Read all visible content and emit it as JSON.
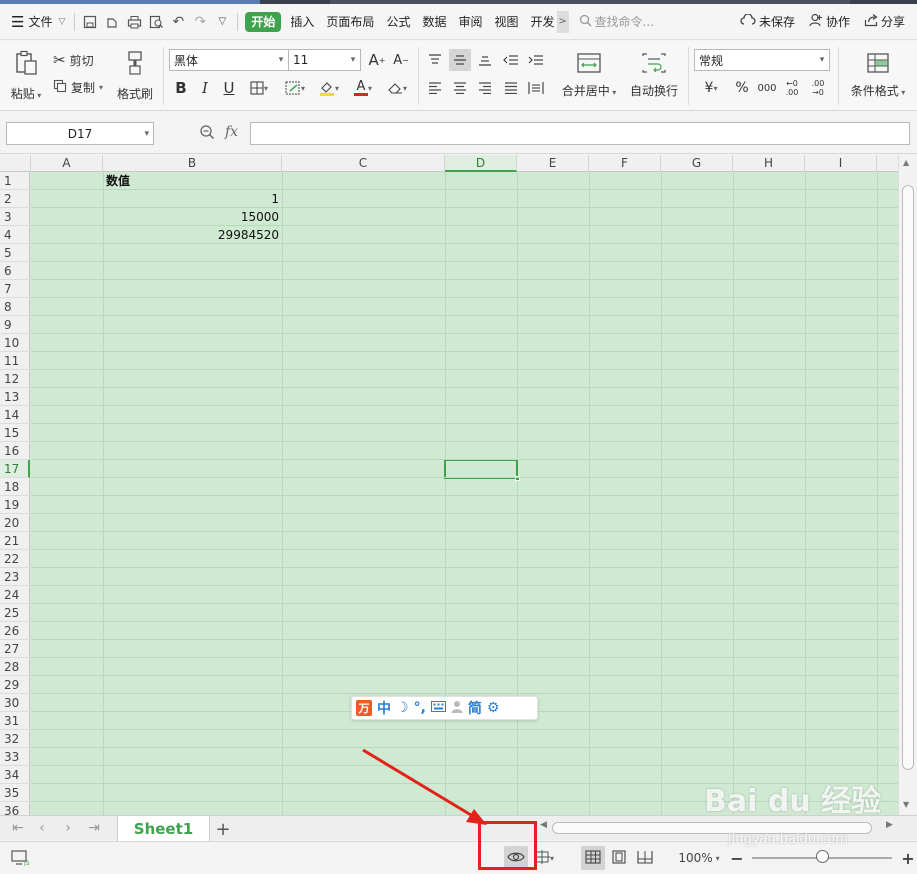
{
  "menubar": {
    "file_label": "文件",
    "tabs": [
      "开始",
      "插入",
      "页面布局",
      "公式",
      "数据",
      "审阅",
      "视图",
      "开发"
    ],
    "active_tab": "开始",
    "search_placeholder": "查找命令...",
    "unsaved_label": "未保存",
    "collab_label": "协作",
    "share_label": "分享"
  },
  "ribbon": {
    "paste_label": "粘贴",
    "cut_label": "剪切",
    "copy_label": "复制",
    "format_painter_label": "格式刷",
    "font_name": "黑体",
    "font_size": "11",
    "bold_label": "B",
    "italic_label": "I",
    "underline_label": "U",
    "font_color_label": "A",
    "merge_center_label": "合并居中",
    "wrap_text_label": "自动换行",
    "number_format": "常规",
    "currency_label": "¥",
    "percent_label": "%",
    "thousands_label": "000",
    "inc_decimal_label": "←0 .00",
    "dec_decimal_label": ".00 →0",
    "conditional_format_label": "条件格式"
  },
  "formulabar": {
    "cell_ref": "D17",
    "fx_label": "fx",
    "formula_value": ""
  },
  "grid": {
    "columns": [
      "A",
      "B",
      "C",
      "D",
      "E",
      "F",
      "G",
      "H",
      "I"
    ],
    "active_column": "D",
    "rows": [
      "1",
      "2",
      "3",
      "4",
      "5",
      "6",
      "7",
      "8",
      "9",
      "10",
      "11",
      "12",
      "13",
      "14",
      "15",
      "16",
      "17",
      "18",
      "19",
      "20",
      "21",
      "22",
      "23",
      "24",
      "25",
      "26",
      "27",
      "28",
      "29",
      "30",
      "31",
      "32",
      "33",
      "34",
      "35",
      "36"
    ],
    "active_row": "17",
    "cells": {
      "B1": "数值",
      "B2": "1",
      "B3": "15000",
      "B4": "29984520"
    }
  },
  "ime": {
    "mode_label": "中",
    "simplified_label": "简"
  },
  "sheetbar": {
    "sheet_name": "Sheet1",
    "add_label": "+"
  },
  "statusbar": {
    "zoom_label": "100%",
    "zoom_level": 100
  },
  "watermark": {
    "brand": "Bai du 经验",
    "site": "jingyan.baidu.com"
  },
  "colors": {
    "accent": "#3fa34d",
    "grid_bg": "#cfe9d2",
    "annotation_red": "#e2231a"
  }
}
